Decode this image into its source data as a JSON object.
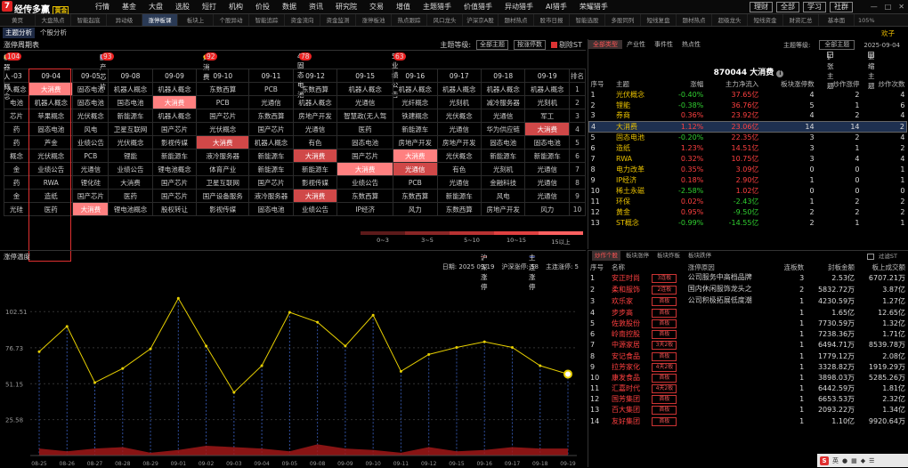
{
  "app": {
    "logo": "7",
    "name": "经传多赢",
    "edition": "黄金"
  },
  "menus": [
    "行情",
    "基金",
    "大盘",
    "选股",
    "短打",
    "机构",
    "价投",
    "数据",
    "资讯",
    "研究院",
    "交易",
    "增值",
    "主题猎手",
    "价值猎手",
    "异动猎手",
    "AI猎手",
    "荣耀猎手"
  ],
  "right_buttons": [
    "理财",
    "全部",
    "学习",
    "社群"
  ],
  "window_controls": [
    "—",
    "□",
    "✕"
  ],
  "tabs": [
    "黄页",
    "大盘热点",
    "智能起底",
    "异动级",
    "涨停板课",
    "板块上",
    "个股异动",
    "智能追踪",
    "资金流向",
    "资金监测",
    "涨停板池",
    "热点跟踪",
    "风口龙头",
    "沪深京A股",
    "题材热点",
    "股市日报",
    "智能选股",
    "多股同列",
    "短线复盘",
    "题材热点",
    "超级龙头",
    "短线资金",
    "财资汇总",
    "基本面"
  ],
  "active_tab": 4,
  "zoom": "105%",
  "subtabs": [
    "主题分析",
    "个股分析"
  ],
  "corner_label": "欢子",
  "left": {
    "title": "涨停周期表",
    "ctrl_label": "主题等级:",
    "ctrl_sel1": "全部主题",
    "ctrl_sel2": "按涨停数",
    "ctrl_check": "剔除ST",
    "legend": [
      {
        "label": "机器人概念",
        "badge": "104"
      },
      {
        "label": "国产芯片",
        "badge": "93"
      },
      {
        "label": "大消费",
        "badge": "92"
      },
      {
        "label": "4. 固态电池",
        "badge": "78"
      },
      {
        "label": "5. 业绩公告",
        "badge": "63"
      }
    ],
    "columns": [
      "-03",
      "09-04",
      "09-05",
      "09-08",
      "09-09",
      "09-10",
      "09-11",
      "09-12",
      "09-15",
      "09-16",
      "09-17",
      "09-18",
      "09-19",
      "排名"
    ],
    "rows": [
      [
        "人概念",
        "大消费",
        "固态电池",
        "机器人概念",
        "机器人概念",
        "东数西算",
        "PCB",
        "东数西算",
        "机器人概念",
        "机器人概念",
        "机器人概念",
        "机器人概念",
        "机器人概念",
        "1"
      ],
      [
        "电池",
        "机器人概念",
        "固态电池",
        "国态电池",
        "大消费",
        "PCB",
        "光通信",
        "机器人概念",
        "光通信",
        "光纤概念",
        "光刻机",
        "减冷服务器",
        "光刻机",
        "2"
      ],
      [
        "芯片",
        "苹果概念",
        "光伏概念",
        "新能源车",
        "机器人概念",
        "国产芯片",
        "东数西算",
        "房地产开发",
        "智慧政(无人驾",
        "铁建概念",
        "光伏概念",
        "光通信",
        "军工",
        "3"
      ],
      [
        "药",
        "固态电池",
        "风电",
        "卫星互联网",
        "国产芯片",
        "光伏概念",
        "国产芯片",
        "光通信",
        "医药",
        "新能源车",
        "光通信",
        "华为供应链",
        "大消费",
        "4"
      ],
      [
        "药",
        "芦金",
        "业绩公告",
        "光伏概念",
        "影视传媒",
        "大消费",
        "机器人概念",
        "有色",
        "固态电池",
        "房地产开发",
        "房地产开发",
        "固态电池",
        "固态电池",
        "5"
      ],
      [
        "概念",
        "光伏概念",
        "PCB",
        "锂能",
        "新能源车",
        "液冷服务器",
        "新能源车",
        "大消费",
        "国产芯片",
        "大消费",
        "光伏概念",
        "新能源车",
        "新能源车",
        "6"
      ],
      [
        "金",
        "业绩公告",
        "光通信",
        "业绩公告",
        "锂电池概念",
        "体育产业",
        "新能源车",
        "新能源车",
        "大消费",
        "光通信",
        "有色",
        "光刻机",
        "光通信",
        "7"
      ],
      [
        "药",
        "RWA",
        "锂化硅",
        "大消费",
        "国产芯片",
        "卫星互联网",
        "国产芯片",
        "影视传媒",
        "业绩公告",
        "PCB",
        "光通信",
        "金融科技",
        "光通信",
        "8"
      ],
      [
        "金",
        "造纸",
        "国产芯片",
        "医药",
        "国产芯片",
        "国产设备服务",
        "液冷服务器",
        "大消费",
        "东数西算",
        "东数西算",
        "新能源车",
        "风电",
        "光通信",
        "9"
      ],
      [
        "光硅",
        "医药",
        "大消费",
        "锂电池概念",
        "股权转让",
        "影视传媒",
        "固态电池",
        "业绩公告",
        "IP经济",
        "风力",
        "东数西算",
        "房地产开发",
        "风力",
        "10"
      ]
    ],
    "highlights": [
      [
        0,
        1
      ],
      [
        1,
        4
      ],
      [
        3,
        12
      ],
      [
        4,
        5
      ],
      [
        5,
        7
      ],
      [
        6,
        8
      ],
      [
        6,
        9
      ],
      [
        8,
        7
      ],
      [
        9,
        2
      ],
      [
        5,
        9
      ]
    ],
    "scale": [
      {
        "label": "0~3",
        "color": "#5c1a1a"
      },
      {
        "label": "3~5",
        "color": "#8a2626"
      },
      {
        "label": "5~10",
        "color": "#b83232"
      },
      {
        "label": "10~15",
        "color": "#e04040"
      },
      {
        "label": "15以上",
        "color": "#ff6060"
      }
    ]
  },
  "right": {
    "tabs": [
      "全部类型",
      "产业性",
      "事件性",
      "热点性"
    ],
    "ctrl_label": "主题等级:",
    "ctrl_sel": "全部主题",
    "date": "2025-09-04",
    "checks": [
      "扩张主题",
      "萎缩主题"
    ],
    "title": "870044 大消费",
    "headers": [
      "序号",
      "主题",
      "涨幅",
      "主力净流入",
      "板块涨停数",
      "炒作涨停",
      "炒作次数"
    ],
    "rows": [
      [
        "1",
        "光伏概念",
        "-0.40%",
        "37.65亿",
        "4",
        "2",
        "4"
      ],
      [
        "2",
        "锂能",
        "-0.38%",
        "36.76亿",
        "5",
        "1",
        "6"
      ],
      [
        "3",
        "券商",
        "0.36%",
        "23.92亿",
        "4",
        "2",
        "4"
      ],
      [
        "4",
        "大消费",
        "1.12%",
        "23.06亿",
        "14",
        "14",
        "2"
      ],
      [
        "5",
        "固态电池",
        "-0.20%",
        "22.35亿",
        "3",
        "2",
        "4"
      ],
      [
        "6",
        "造纸",
        "1.23%",
        "14.51亿",
        "3",
        "1",
        "2"
      ],
      [
        "7",
        "RWA",
        "0.32%",
        "10.75亿",
        "3",
        "4",
        "4"
      ],
      [
        "8",
        "电力改革",
        "0.35%",
        "3.09亿",
        "0",
        "0",
        "1"
      ],
      [
        "9",
        "IP经济",
        "0.18%",
        "2.90亿",
        "1",
        "0",
        "1"
      ],
      [
        "10",
        "稀土永磁",
        "-2.58%",
        "1.02亿",
        "0",
        "0",
        "0"
      ],
      [
        "11",
        "环保",
        "0.02%",
        "-2.43亿",
        "1",
        "2",
        "2"
      ],
      [
        "12",
        "黄金",
        "0.95%",
        "-9.50亿",
        "2",
        "2",
        "2"
      ],
      [
        "13",
        "ST概念",
        "-0.99%",
        "-14.55亿",
        "2",
        "1",
        "1"
      ]
    ],
    "selected_row": 3
  },
  "chart": {
    "title": "涨停温度",
    "legend": [
      "沪深涨停",
      "主连涨停"
    ],
    "date_label": "日期: 2025 09 19",
    "hushen_label": "沪深涨停: 58",
    "zhulian_label": "主连涨停: 5",
    "y_ticks": [
      "102.51",
      "76.73",
      "51.15",
      "25.58"
    ]
  },
  "chart_data": {
    "type": "line",
    "x": [
      "08-25",
      "08-26",
      "08-27",
      "08-28",
      "08-29",
      "09-01",
      "09-02",
      "09-03",
      "09-04",
      "09-05",
      "09-08",
      "09-09",
      "09-10",
      "09-11",
      "09-12",
      "09-15",
      "09-16",
      "09-17",
      "09-18",
      "09-19"
    ],
    "series": [
      {
        "name": "沪深涨停",
        "values": [
          74,
          92,
          52,
          62,
          76,
          112,
          78,
          45,
          64,
          102,
          95,
          78,
          100,
          60,
          72,
          77,
          81,
          77,
          64,
          58
        ]
      },
      {
        "name": "主连涨停",
        "values": [
          5,
          3,
          5,
          6,
          2,
          4,
          7,
          6,
          5,
          3,
          8,
          5,
          4,
          2,
          6,
          3,
          4,
          6,
          5,
          5
        ]
      }
    ],
    "ylim": [
      0,
      128
    ]
  },
  "zd": {
    "tabs": [
      "炒作个股",
      "板块涨停",
      "板块炸板",
      "板块跌停"
    ],
    "filter": "过滤ST",
    "headers": [
      "序号",
      "名称",
      "",
      "涨停原因",
      "连板数",
      "封板金额",
      "板上成交额"
    ],
    "rows": [
      [
        "1",
        "安正时尚",
        "3连板",
        "公司服务中高档品牌",
        "3",
        "2.53亿",
        "6707.21万"
      ],
      [
        "2",
        "柔和服饰",
        "2连板",
        "国内休闲服饰龙头之",
        "2",
        "5832.72万",
        "3.87亿"
      ],
      [
        "3",
        "欢乐家",
        "首板",
        "公司积极拓展低度潮",
        "1",
        "4230.59万",
        "1.27亿"
      ],
      [
        "4",
        "步步高",
        "首板",
        "",
        "1",
        "1.65亿",
        "12.65亿"
      ],
      [
        "5",
        "佐敦股份",
        "首板",
        "",
        "1",
        "7730.59万",
        "1.32亿"
      ],
      [
        "6",
        "岭南控股",
        "首板",
        "",
        "1",
        "7238.36万",
        "1.71亿"
      ],
      [
        "7",
        "中源家居",
        "3天2板",
        "",
        "1",
        "6494.71万",
        "8539.78万"
      ],
      [
        "8",
        "安记食品",
        "首板",
        "",
        "1",
        "1779.12万",
        "2.08亿"
      ],
      [
        "9",
        "拉芳家化",
        "4天2板",
        "",
        "1",
        "3328.82万",
        "1919.29万"
      ],
      [
        "10",
        "康发食品",
        "首板",
        "",
        "1",
        "3898.03万",
        "5285.26万"
      ],
      [
        "11",
        "汇嘉时代",
        "4天2板",
        "",
        "1",
        "6442.59万",
        "1.81亿"
      ],
      [
        "12",
        "国芳集团",
        "首板",
        "",
        "1",
        "6653.53万",
        "2.32亿"
      ],
      [
        "13",
        "百大集团",
        "首板",
        "",
        "1",
        "2093.22万",
        "1.34亿"
      ],
      [
        "14",
        "友好集团",
        "首板",
        "",
        "1",
        "1.10亿",
        "9920.64万"
      ]
    ]
  },
  "tray": {
    "label": "英"
  }
}
